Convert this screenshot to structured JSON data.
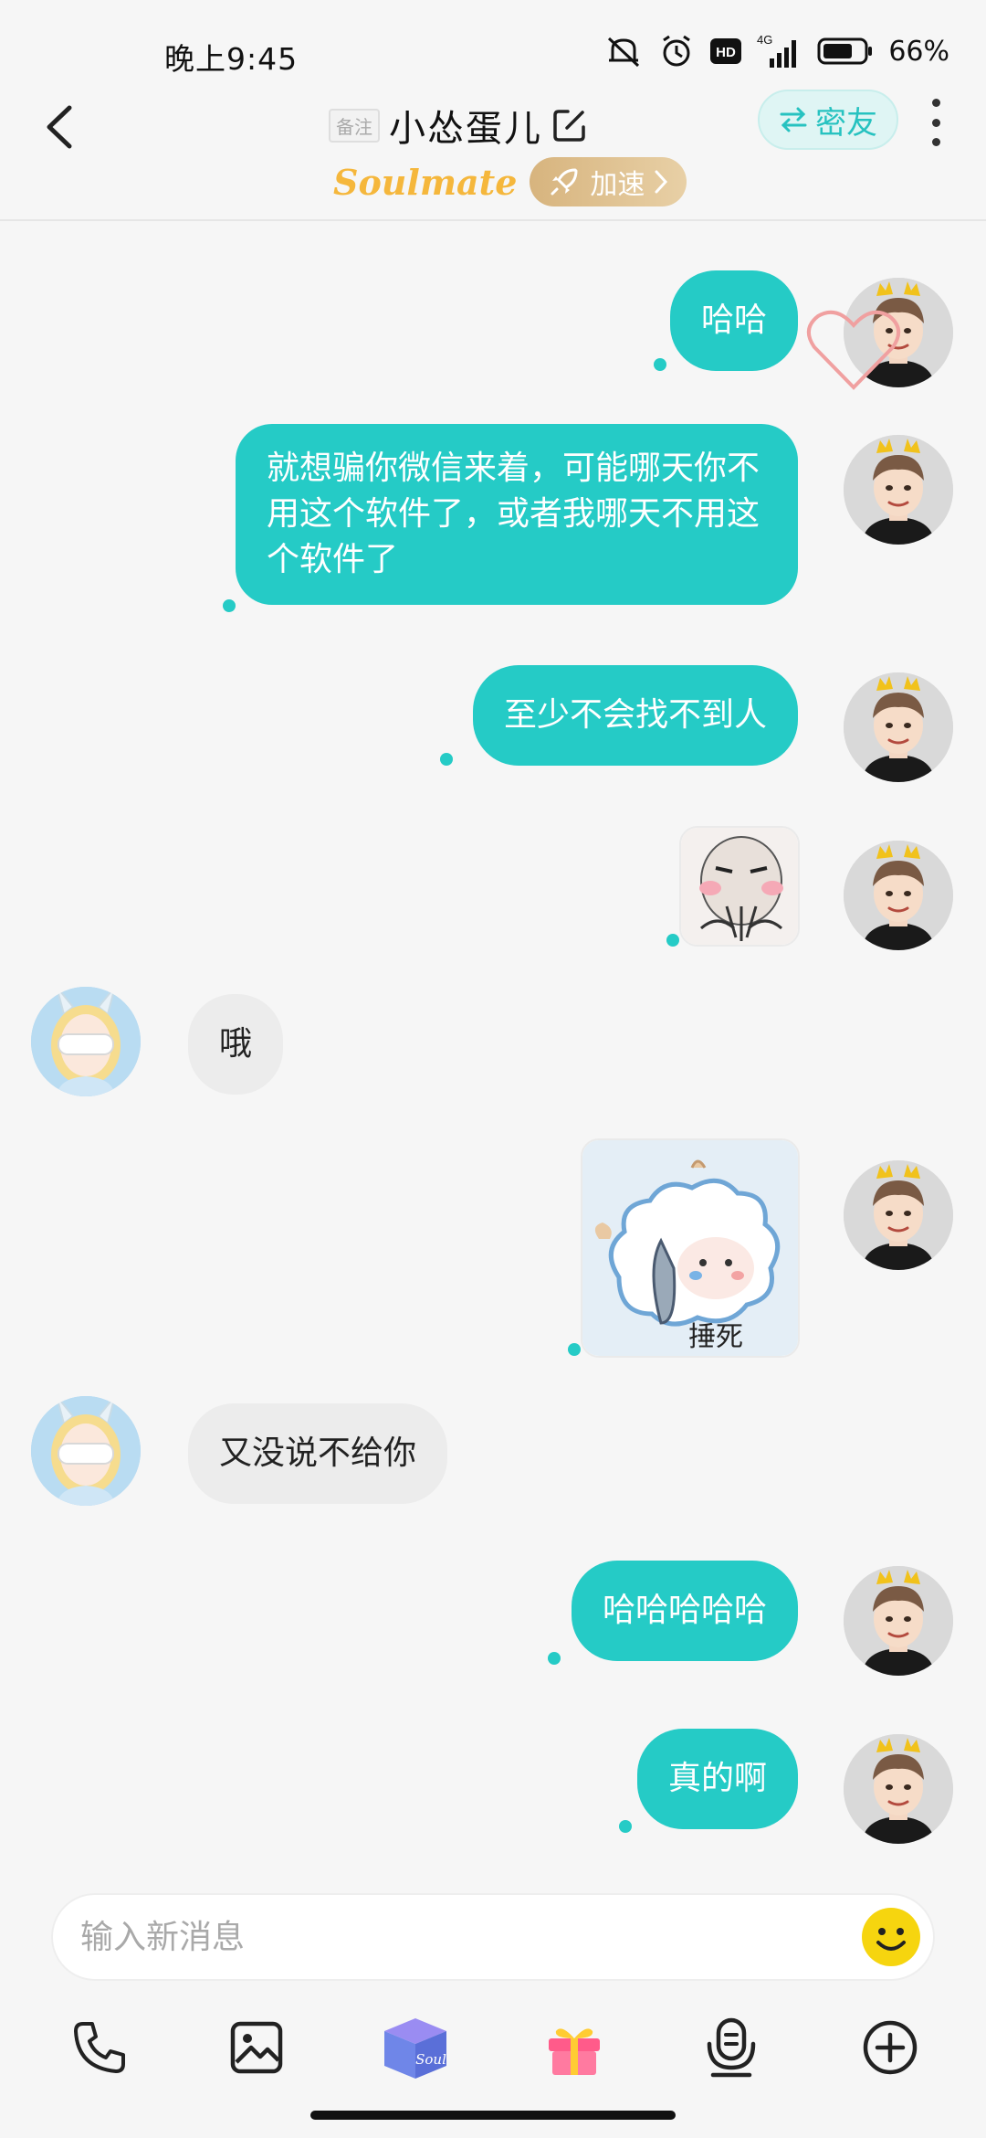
{
  "status_bar": {
    "time": "晚上9:45",
    "network": "4G",
    "hd_label": "HD",
    "battery": "66%"
  },
  "header": {
    "remark_tag": "备注",
    "title": "小怂蛋儿",
    "friend_button": "密友",
    "soulmate_label": "Soulmate",
    "speed_button": "加速"
  },
  "messages": [
    {
      "sender": "me",
      "type": "text",
      "text": "哈哈"
    },
    {
      "sender": "me",
      "type": "text",
      "text": "就想骗你微信来着，可能哪天你不用这个软件了，或者我哪天不用这个软件了"
    },
    {
      "sender": "me",
      "type": "text",
      "text": "至少不会找不到人"
    },
    {
      "sender": "me",
      "type": "sticker"
    },
    {
      "sender": "peer",
      "type": "text",
      "text": "哦"
    },
    {
      "sender": "me",
      "type": "sticker",
      "caption": "捶死"
    },
    {
      "sender": "peer",
      "type": "text",
      "text": "又没说不给你"
    },
    {
      "sender": "me",
      "type": "text",
      "text": "哈哈哈哈哈"
    },
    {
      "sender": "me",
      "type": "text",
      "text": "真的啊"
    }
  ],
  "input": {
    "placeholder": "输入新消息"
  },
  "toolbar": {
    "items": [
      "phone-icon",
      "image-icon",
      "soul-box-icon",
      "gift-icon",
      "voice-icon",
      "plus-icon"
    ],
    "soul_box_label": "Soul"
  },
  "colors": {
    "accent": "#25cbc6",
    "peer_bubble": "#ececec",
    "soulmate": "#f5b73c",
    "speed_button": "#d7b47e"
  }
}
